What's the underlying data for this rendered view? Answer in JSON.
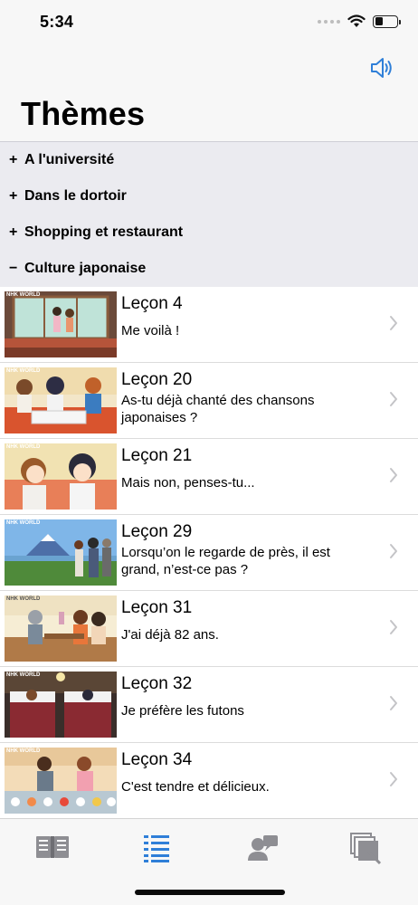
{
  "status_bar": {
    "time": "5:34",
    "battery_level": 0.35
  },
  "header": {
    "title": "Thèmes",
    "speaker_icon": "speaker-icon",
    "accent_color": "#2f7fd8"
  },
  "sections": [
    {
      "sign": "+",
      "label": "A l'université",
      "expanded": false
    },
    {
      "sign": "+",
      "label": "Dans le dortoir",
      "expanded": false
    },
    {
      "sign": "+",
      "label": "Shopping et restaurant",
      "expanded": false
    },
    {
      "sign": "−",
      "label": "Culture japonaise",
      "expanded": true
    }
  ],
  "lessons": [
    {
      "title": "Leçon 4",
      "subtitle": "Me voilà !",
      "thumb_caption": "NHK WORLD"
    },
    {
      "title": "Leçon 20",
      "subtitle": "As-tu déjà chanté des chansons japonaises ?",
      "thumb_caption": "NHK WORLD"
    },
    {
      "title": "Leçon 21",
      "subtitle": "Mais non, penses-tu...",
      "thumb_caption": "NHK WORLD"
    },
    {
      "title": "Leçon 29",
      "subtitle": "Lorsqu’on le regarde de près, il est grand, n’est-ce pas ?",
      "thumb_caption": "NHK WORLD"
    },
    {
      "title": "Leçon 31",
      "subtitle": "J'ai déjà 82 ans.",
      "thumb_caption": "NHK WORLD"
    },
    {
      "title": "Leçon 32",
      "subtitle": "Je préfère les futons",
      "thumb_caption": "NHK WORLD"
    },
    {
      "title": "Leçon 34",
      "subtitle": "C'est tendre et délicieux.",
      "thumb_caption": "NHK WORLD"
    }
  ],
  "tabs": [
    {
      "icon": "book-icon",
      "active": false
    },
    {
      "icon": "list-icon",
      "active": true
    },
    {
      "icon": "chat-person-icon",
      "active": false
    },
    {
      "icon": "cards-icon",
      "active": false
    }
  ],
  "colors": {
    "active_tab": "#2f7fd8",
    "inactive_tab": "#8e8e93",
    "section_bg": "#ebebf0"
  }
}
